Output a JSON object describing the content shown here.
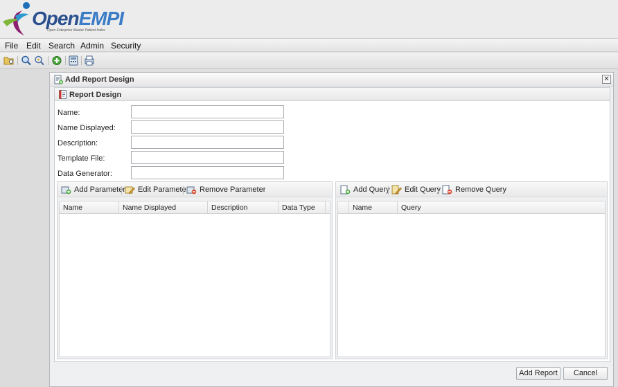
{
  "app": {
    "logo_title_open": "Open",
    "logo_title_empi": "EMPI",
    "logo_subtitle": "Open Enterprise Master Patient Index"
  },
  "menubar": {
    "items": [
      "File",
      "Edit",
      "Search",
      "Admin",
      "Security"
    ]
  },
  "toolbar": {
    "icons": [
      "folder-search-icon",
      "zoom-search-icon",
      "key-search-icon",
      "add-icon",
      "calculator-icon",
      "print-icon"
    ]
  },
  "dialog": {
    "title": "Add Report Design",
    "close_label": "✕",
    "panel_title": "Report Design",
    "fields": [
      {
        "label": "Name:",
        "value": ""
      },
      {
        "label": "Name Displayed:",
        "value": ""
      },
      {
        "label": "Description:",
        "value": ""
      },
      {
        "label": "Template File:",
        "value": ""
      },
      {
        "label": "Data Generator:",
        "value": ""
      }
    ],
    "parameters": {
      "add_label": "Add Parameter",
      "edit_label": "Edit Parameter",
      "remove_label": "Remove Parameter",
      "columns": [
        "Name",
        "Name Displayed",
        "Description",
        "Data Type"
      ],
      "rows": []
    },
    "queries": {
      "add_label": "Add Query",
      "edit_label": "Edit Query",
      "remove_label": "Remove Query",
      "columns": [
        "Name",
        "Query"
      ],
      "rows": []
    },
    "buttons": {
      "add_report": "Add Report",
      "cancel": "Cancel"
    }
  },
  "colors": {
    "logo_dark": "#2a4f8f",
    "logo_light": "#3a7cc7",
    "dialog_bg": "#eef0f2"
  }
}
